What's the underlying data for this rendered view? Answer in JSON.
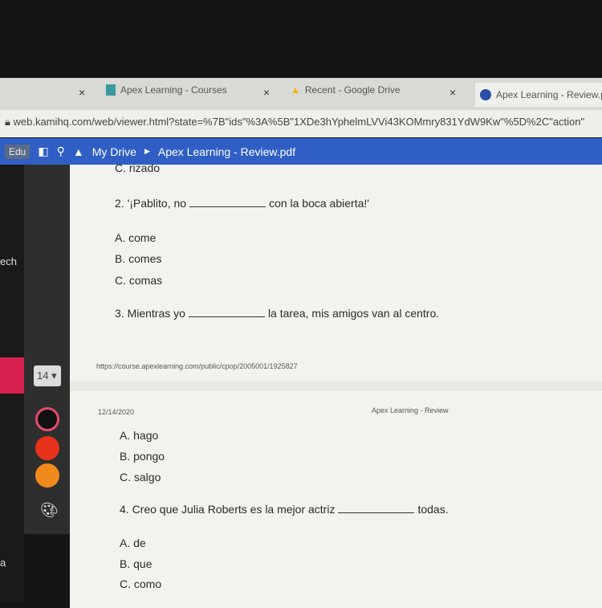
{
  "browser": {
    "tabs": [
      {
        "label": "Apex Learning - Courses",
        "icon": "apex-courses-icon"
      },
      {
        "label": "Recent - Google Drive",
        "icon": "google-drive-icon"
      },
      {
        "label": "Apex Learning - Review.pd",
        "icon": "kami-icon"
      }
    ],
    "url": "web.kamihq.com/web/viewer.html?state=%7B\"ids\"%3A%5B\"1XDe3hYphelmLVVi43KOMmry831YdW9Kw\"%5D%2C\"action\""
  },
  "toolbar": {
    "edu": "Edu",
    "breadcrumb_root": "My Drive",
    "file": "Apex Learning - Review.pdf"
  },
  "left_sidebar": {
    "label1": "ech",
    "label2": "a"
  },
  "tools": {
    "font_size": "14",
    "colors": [
      "#111111",
      "#e8321c",
      "#f08a1c"
    ]
  },
  "page1": {
    "prev_option": "C. rizado",
    "q2": {
      "before": "2. '¡Pablito, no",
      "after": "con la boca abierta!'",
      "options": [
        "A. come",
        "B. comes",
        "C. comas"
      ]
    },
    "q3": {
      "before": "3. Mientras yo",
      "after": "la tarea, mis amigos van al centro."
    },
    "footer_url": "https://course.apexlearning.com/public/cpop/2005001/1925827"
  },
  "page2": {
    "date": "12/14/2020",
    "header": "Apex Learning - Review",
    "q3_options": [
      "A. hago",
      "B. pongo",
      "C. salgo"
    ],
    "q4": {
      "before": "4. Creo que Julia Roberts es la mejor actriz",
      "after": "todas.",
      "options": [
        "A. de",
        "B. que",
        "C. como"
      ]
    }
  }
}
